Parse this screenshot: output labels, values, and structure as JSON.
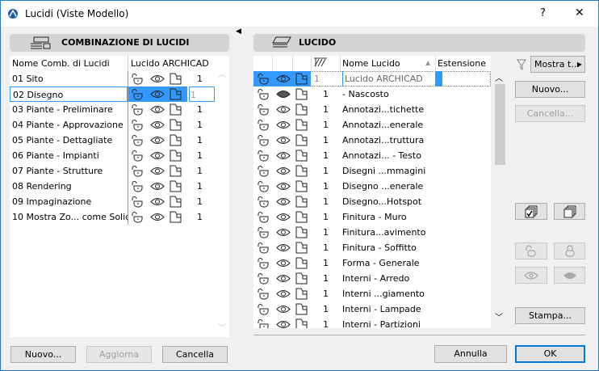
{
  "window": {
    "title": "Lucidi (Viste Modello)",
    "help": "?",
    "close": "✕"
  },
  "left": {
    "header": "COMBINAZIONE DI LUCIDI",
    "col_name": "Nome Comb. di Lucidi",
    "col_layer": "Lucido ARCHICAD",
    "rows": [
      {
        "name": "01 Sito",
        "num": "1"
      },
      {
        "name": "02 Disegno",
        "num": "1",
        "selected": true
      },
      {
        "name": "03 Piante - Preliminare",
        "num": "1"
      },
      {
        "name": "04 Piante - Approvazione",
        "num": "1"
      },
      {
        "name": "05 Piante - Dettagliate",
        "num": "1"
      },
      {
        "name": "06 Piante - Impianti",
        "num": "1"
      },
      {
        "name": "07 Piante - Strutture",
        "num": "1"
      },
      {
        "name": "08 Rendering",
        "num": "1"
      },
      {
        "name": "09 Impaginazione",
        "num": "1"
      },
      {
        "name": "10 Mostra Zo... come Solidi",
        "num": "1"
      }
    ],
    "buttons": {
      "new": "Nuovo...",
      "update": "Aggiorna",
      "delete": "Cancella"
    }
  },
  "right": {
    "header": "LUCIDO",
    "col_name": "Nome Lucido",
    "col_ext": "Estensione",
    "rows": [
      {
        "name": "Lucido ARCHICAD",
        "num": "1",
        "selected": true
      },
      {
        "name": "- Nascosto",
        "num": "1",
        "hidden": true
      },
      {
        "name": "Annotazi...tichette",
        "num": "1"
      },
      {
        "name": "Annotazi...enerale",
        "num": "1"
      },
      {
        "name": "Annotazi...truttura",
        "num": "1"
      },
      {
        "name": "Annotazi... - Testo",
        "num": "1"
      },
      {
        "name": "Disegni ...mmagini",
        "num": "1"
      },
      {
        "name": "Disegno ...enerale",
        "num": "1"
      },
      {
        "name": "Disegno...Hotspot",
        "num": "1"
      },
      {
        "name": "Finitura - Muro",
        "num": "1"
      },
      {
        "name": "Finitura...avimento",
        "num": "1"
      },
      {
        "name": "Finitura - Soffitto",
        "num": "1"
      },
      {
        "name": "Forma - Generale",
        "num": "1"
      },
      {
        "name": "Interni - Arredo",
        "num": "1"
      },
      {
        "name": "Interni ...giamento",
        "num": "1"
      },
      {
        "name": "Interni - Lampade",
        "num": "1"
      },
      {
        "name": "Interni - Partizioni",
        "num": "1"
      }
    ],
    "show_all": "Mostra t...",
    "new": "Nuovo...",
    "delete": "Cancella...",
    "print": "Stampa..."
  },
  "footer": {
    "cancel": "Annulla",
    "ok": "OK"
  }
}
